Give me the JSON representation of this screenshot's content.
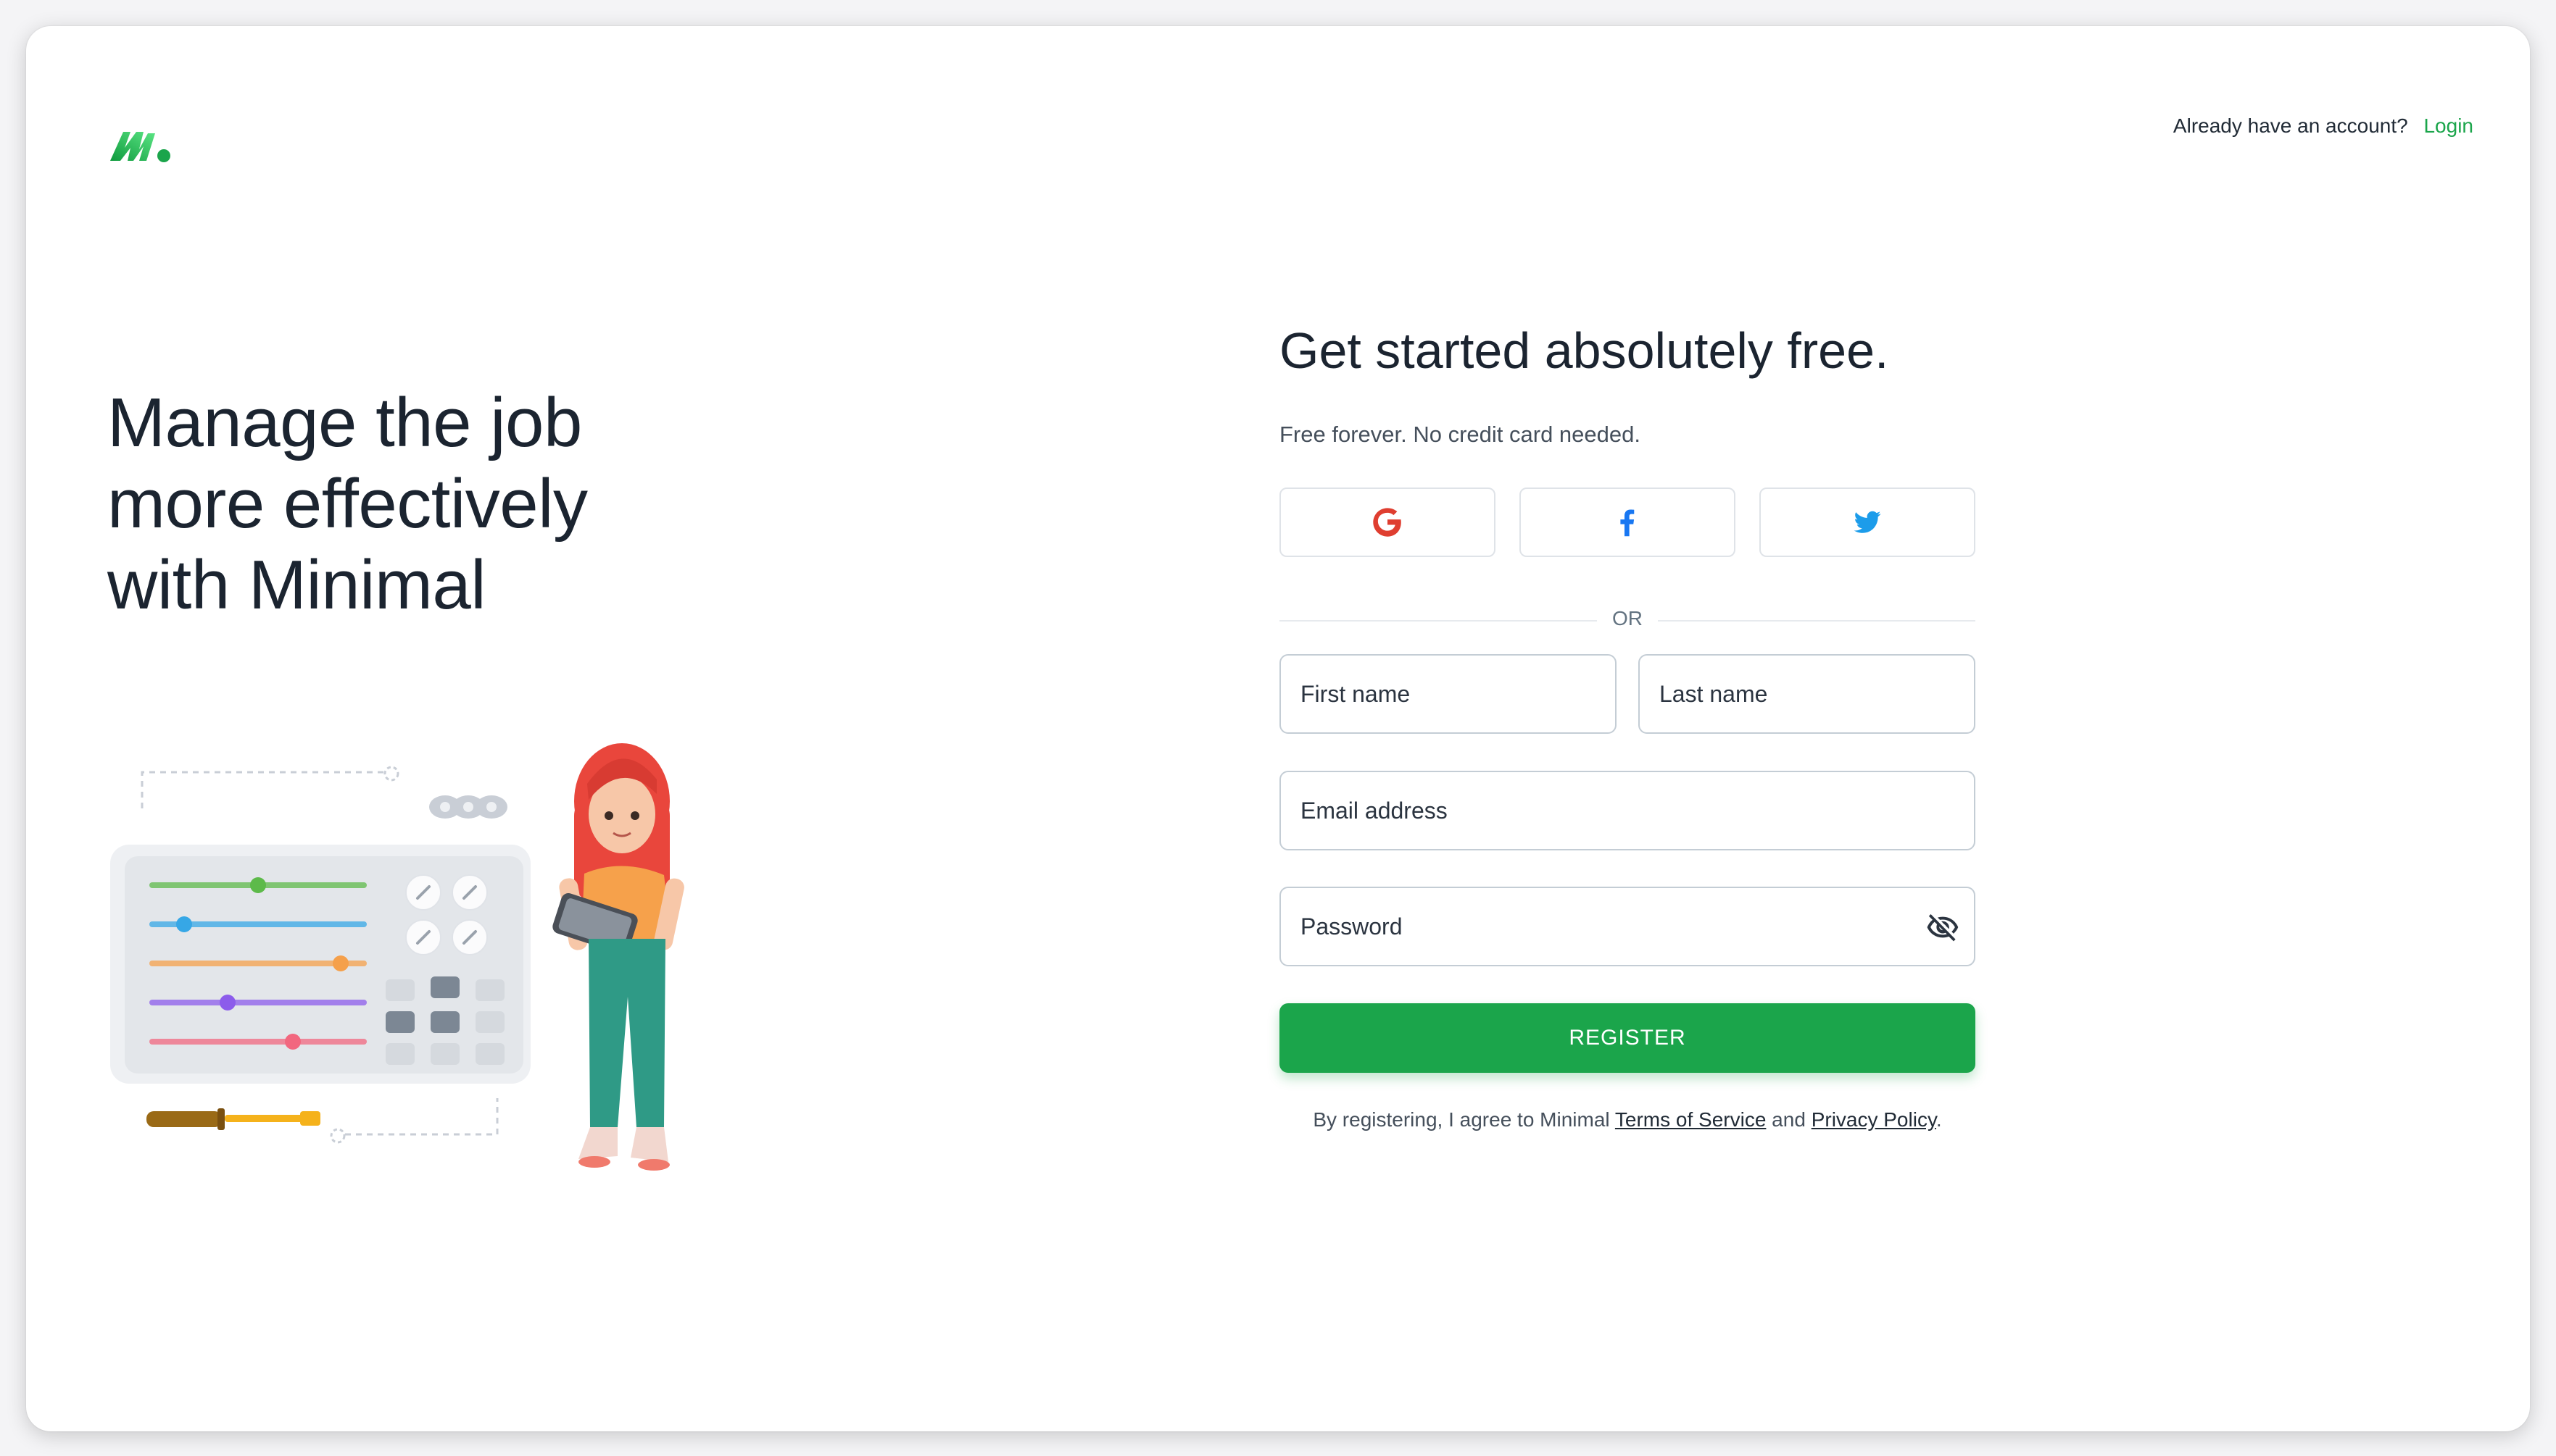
{
  "brand": {
    "accent": "#1BA54B",
    "text_color": "#212B36"
  },
  "header": {
    "prompt_text": "Already have an account?",
    "login_label": "Login"
  },
  "hero": {
    "line1": "Manage the job",
    "line2": "more effectively",
    "line3": "with Minimal"
  },
  "form": {
    "title": "Get started absolutely free.",
    "subtitle": "Free forever. No credit card needed.",
    "social_buttons": [
      {
        "icon": "google-icon",
        "color": "#DF3E30"
      },
      {
        "icon": "facebook-icon",
        "color": "#1877F2"
      },
      {
        "icon": "twitter-icon",
        "color": "#1C9CEA"
      }
    ],
    "divider_text": "OR",
    "first_name_label": "First name",
    "last_name_label": "Last name",
    "email_label": "Email address",
    "password_label": "Password",
    "password_toggle_icon": "eye-off-icon",
    "register_label": "REGISTER",
    "terms_prefix": "By registering, I agree to Minimal ",
    "terms_link": "Terms of Service",
    "terms_and": " and ",
    "privacy_link": "Privacy Policy",
    "terms_suffix": "."
  },
  "illustration": {
    "slider_levels": [
      0.5,
      0.16,
      0.88,
      0.36,
      0.66
    ],
    "slider_colors": [
      "#5DBA4A",
      "#36A7E6",
      "#F5A04B",
      "#8C5CEB",
      "#F2677F"
    ]
  }
}
